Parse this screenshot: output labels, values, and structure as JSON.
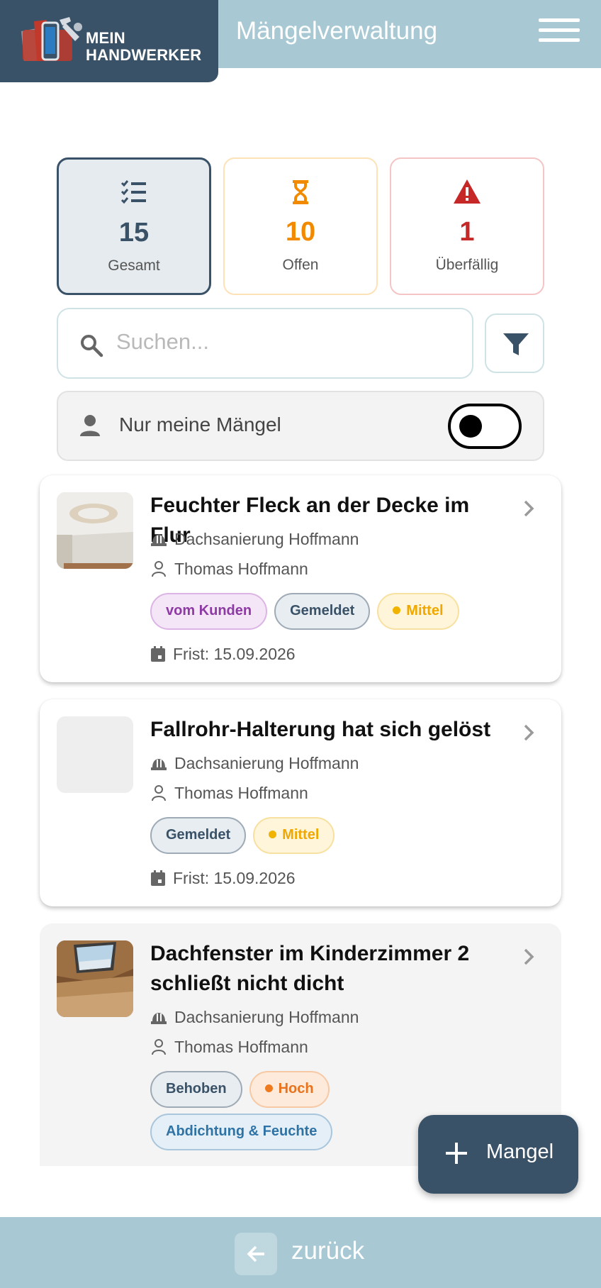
{
  "header": {
    "logo_line1": "MEIN",
    "logo_line2": "HANDWERKER",
    "title": "Mängelverwaltung",
    "menu_icon": "hamburger-menu-icon"
  },
  "stats": {
    "total": {
      "value": "15",
      "label": "Gesamt",
      "icon": "checklist-icon",
      "color": "#3a5268"
    },
    "open": {
      "value": "10",
      "label": "Offen",
      "icon": "hourglass-icon",
      "color": "#f28a00"
    },
    "overdue": {
      "value": "1",
      "label": "Überfällig",
      "icon": "warning-icon",
      "color": "#c62828"
    }
  },
  "search": {
    "placeholder": "Suchen...",
    "value": ""
  },
  "filter_icon": "filter-icon",
  "mine_toggle": {
    "label": "Nur meine Mängel",
    "enabled": false
  },
  "defects": [
    {
      "title": "Feuchter Fleck an der Decke im Flur",
      "project": "Dachsanierung Hoffmann",
      "person": "Thomas Hoffmann",
      "tags": {
        "source": "vom Kunden",
        "status": "Gemeldet",
        "priority": "Mittel"
      },
      "deadline": "Frist: 15.09.2026"
    },
    {
      "title": "Fallrohr-Halterung hat sich gelöst",
      "project": "Dachsanierung Hoffmann",
      "person": "Thomas Hoffmann",
      "tags": {
        "status": "Gemeldet",
        "priority": "Mittel"
      },
      "deadline": "Frist: 15.09.2026"
    },
    {
      "title": "Dachfenster im Kinderzimmer 2 schließt nicht dicht",
      "project": "Dachsanierung Hoffmann",
      "person": "Thomas Hoffmann",
      "tags": {
        "status": "Behoben",
        "priority": "Hoch",
        "category": "Abdichtung & Feuchte"
      }
    }
  ],
  "fab": {
    "label": "Mangel",
    "icon": "plus-icon"
  },
  "bottom": {
    "back_label": "zurück",
    "icon": "arrow-left-icon"
  },
  "colors": {
    "primary": "#3a5268",
    "header": "#a8c9d4",
    "open": "#f28a00",
    "overdue": "#c62828"
  }
}
